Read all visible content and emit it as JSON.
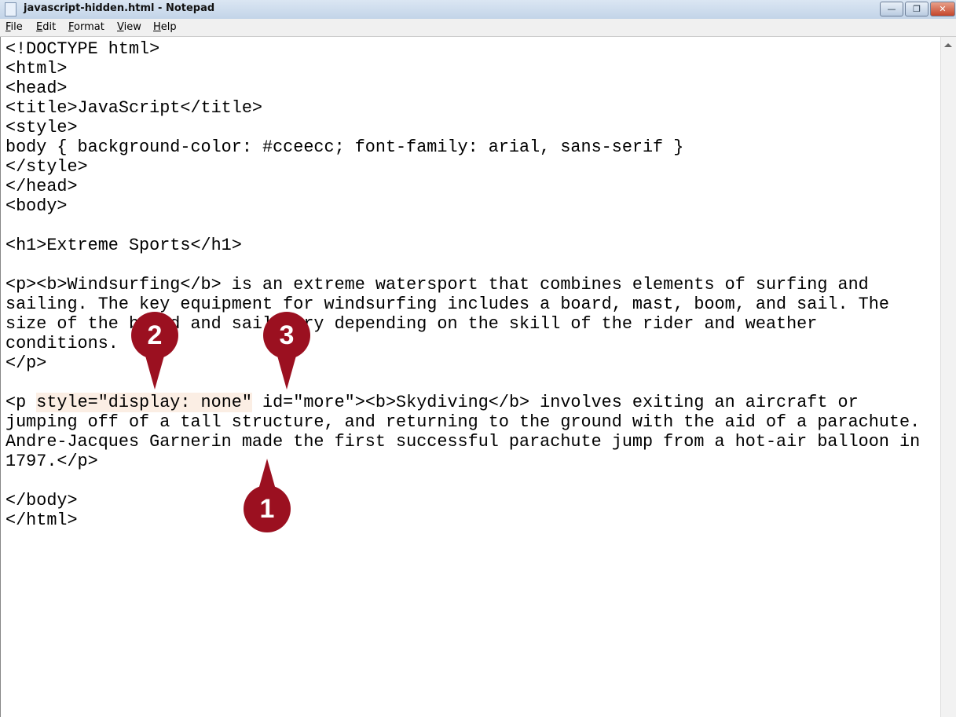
{
  "window": {
    "title": "javascript-hidden.html - Notepad",
    "minimize": "—",
    "restore": "❐",
    "close": "✕"
  },
  "menu": [
    "File",
    "Edit",
    "Format",
    "View",
    "Help"
  ],
  "code": {
    "before": "<!DOCTYPE html>\n<html>\n<head>\n<title>JavaScript</title>\n<style>\nbody { background-color: #cceecc; font-family: arial, sans-serif }\n</style>\n</head>\n<body>\n\n<h1>Extreme Sports</h1>\n\n<p><b>Windsurfing</b> is an extreme watersport that combines elements of surfing and\nsailing. The key equipment for windsurfing includes a board, mast, boom, and sail. The\nsize of the board and sail vary depending on the skill of the rider and weather\nconditions.\n</p>\n\n<p ",
    "highlight": "style=\"display: none\"",
    "after": " id=\"more\"><b>Skydiving</b> involves exiting an aircraft or\njumping off of a tall structure, and returning to the ground with the aid of a parachute.\nAndre-Jacques Garnerin made the first successful parachute jump from a hot-air balloon in\n1797.</p>\n\n</body>\n</html>"
  },
  "callouts": [
    "1",
    "2",
    "3"
  ],
  "colors": {
    "callout": "#9b1020",
    "highlight": "#fbeee4"
  }
}
